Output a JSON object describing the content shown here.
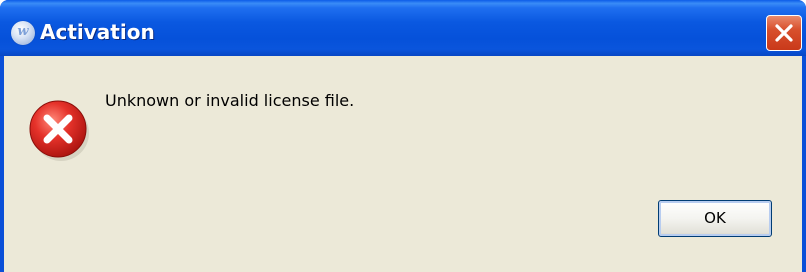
{
  "window": {
    "title": "Activation",
    "app_icon_letter": "w",
    "close_icon": "close-icon"
  },
  "dialog": {
    "icon": "error-icon",
    "message": "Unknown or invalid license file.",
    "ok_label": "OK"
  },
  "colors": {
    "titlebar": "#0a58e0",
    "close_button": "#d8502d",
    "client_background": "#ece9d8",
    "error_icon": "#d8261c"
  }
}
